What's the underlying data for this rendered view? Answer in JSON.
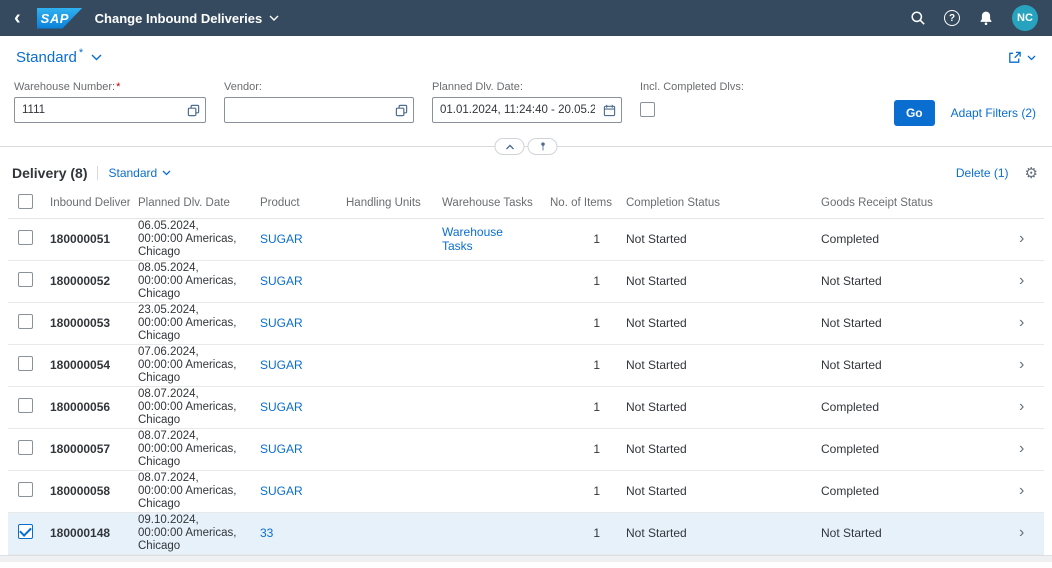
{
  "colors": {
    "shell_bg": "#354a5f",
    "accent_blue": "#0a6ed1",
    "selected_row_bg": "#e7f1fa",
    "required_red": "#bb0000"
  },
  "icons": {
    "nav_back": "left-chevron",
    "logo": "sap-logo",
    "title_dropdown": "chevron-down",
    "search": "magnifier",
    "help": "question-mark-circle",
    "notifications": "bell",
    "share": "export-arrow-box",
    "value_help": "overlapping-squares",
    "date_picker": "calendar",
    "collapse": "chevron-up",
    "pin": "pushpin",
    "settings": "gear",
    "row_nav": "right-chevron"
  },
  "shell": {
    "logo_text": "SAP",
    "app_title": "Change Inbound Deliveries",
    "avatar_initials": "NC"
  },
  "variant_bar": {
    "title": "Standard",
    "dirty_marker": "*"
  },
  "filter_bar": {
    "fields": [
      {
        "label": "Warehouse Number:",
        "required": true,
        "value": "1111",
        "icon": "value-help"
      },
      {
        "label": "Vendor:",
        "required": false,
        "value": "",
        "icon": "value-help"
      },
      {
        "label": "Planned Dlv. Date:",
        "required": false,
        "value": "01.01.2024, 11:24:40 - 20.05.2...",
        "icon": "date-picker"
      },
      {
        "label": "Incl. Completed Dlvs:",
        "type": "checkbox",
        "checked": false
      }
    ],
    "go_button": "Go",
    "adapt_filters": "Adapt Filters (2)"
  },
  "table": {
    "header_title": "Delivery (8)",
    "variant": "Standard",
    "delete_button": "Delete (1)",
    "columns": [
      "Inbound Delivery",
      "Planned Dlv. Date",
      "Product",
      "Handling Units",
      "Warehouse Tasks",
      "No. of Items",
      "Completion Status",
      "Goods Receipt Status"
    ],
    "rows": [
      {
        "inbound_delivery": "180000051",
        "planned_dlv_date": "06.05.2024, 00:00:00 Americas, Chicago",
        "product": "SUGAR",
        "handling_units": "",
        "warehouse_tasks": "Warehouse Tasks",
        "no_of_items": "1",
        "completion_status": "Not Started",
        "goods_receipt_status": "Completed",
        "selected": false
      },
      {
        "inbound_delivery": "180000052",
        "planned_dlv_date": "08.05.2024, 00:00:00 Americas, Chicago",
        "product": "SUGAR",
        "handling_units": "",
        "warehouse_tasks": "",
        "no_of_items": "1",
        "completion_status": "Not Started",
        "goods_receipt_status": "Not Started",
        "selected": false
      },
      {
        "inbound_delivery": "180000053",
        "planned_dlv_date": "23.05.2024, 00:00:00 Americas, Chicago",
        "product": "SUGAR",
        "handling_units": "",
        "warehouse_tasks": "",
        "no_of_items": "1",
        "completion_status": "Not Started",
        "goods_receipt_status": "Not Started",
        "selected": false
      },
      {
        "inbound_delivery": "180000054",
        "planned_dlv_date": "07.06.2024, 00:00:00 Americas, Chicago",
        "product": "SUGAR",
        "handling_units": "",
        "warehouse_tasks": "",
        "no_of_items": "1",
        "completion_status": "Not Started",
        "goods_receipt_status": "Not Started",
        "selected": false
      },
      {
        "inbound_delivery": "180000056",
        "planned_dlv_date": "08.07.2024, 00:00:00 Americas, Chicago",
        "product": "SUGAR",
        "handling_units": "",
        "warehouse_tasks": "",
        "no_of_items": "1",
        "completion_status": "Not Started",
        "goods_receipt_status": "Completed",
        "selected": false
      },
      {
        "inbound_delivery": "180000057",
        "planned_dlv_date": "08.07.2024, 00:00:00 Americas, Chicago",
        "product": "SUGAR",
        "handling_units": "",
        "warehouse_tasks": "",
        "no_of_items": "1",
        "completion_status": "Not Started",
        "goods_receipt_status": "Completed",
        "selected": false
      },
      {
        "inbound_delivery": "180000058",
        "planned_dlv_date": "08.07.2024, 00:00:00 Americas, Chicago",
        "product": "SUGAR",
        "handling_units": "",
        "warehouse_tasks": "",
        "no_of_items": "1",
        "completion_status": "Not Started",
        "goods_receipt_status": "Completed",
        "selected": false
      },
      {
        "inbound_delivery": "180000148",
        "planned_dlv_date": "09.10.2024, 00:00:00 Americas, Chicago",
        "product": "33",
        "handling_units": "",
        "warehouse_tasks": "",
        "no_of_items": "1",
        "completion_status": "Not Started",
        "goods_receipt_status": "Not Started",
        "selected": true
      }
    ]
  }
}
